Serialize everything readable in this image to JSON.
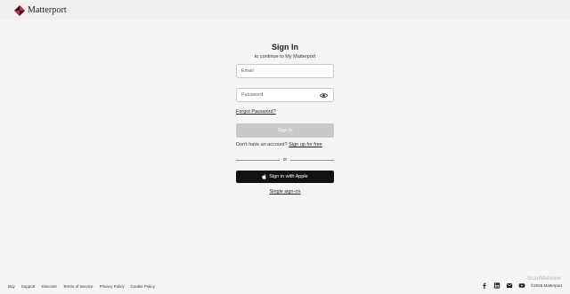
{
  "header": {
    "logo_text": "Matterport"
  },
  "form": {
    "title": "Sign In",
    "subtitle": "to continue to My Matterport",
    "email_placeholder": "Email",
    "password_placeholder": "Password",
    "forgot_label": "Forgot Password?",
    "signin_label": "Sign In",
    "no_account_text": "Don't have an account?",
    "signup_label": "Sign up for free",
    "or_text": "or",
    "apple_label": "Sign in with Apple",
    "sso_label": "Single sign-on"
  },
  "footer": {
    "links": [
      "Buy",
      "Support",
      "Discover",
      "Terms of Service",
      "Privacy Policy",
      "Cookie Policy"
    ],
    "social_icons": [
      "facebook-icon",
      "linkedin-icon",
      "email-icon",
      "youtube-icon"
    ],
    "copyright": "©2026 Matterport"
  },
  "watermark": "ScanMalware",
  "colors": {
    "background": "#f6f5f4",
    "header": "#f1efed",
    "button_disabled": "#c9c9c9",
    "apple_button": "#111111",
    "logo_accent": "#d8203c"
  }
}
